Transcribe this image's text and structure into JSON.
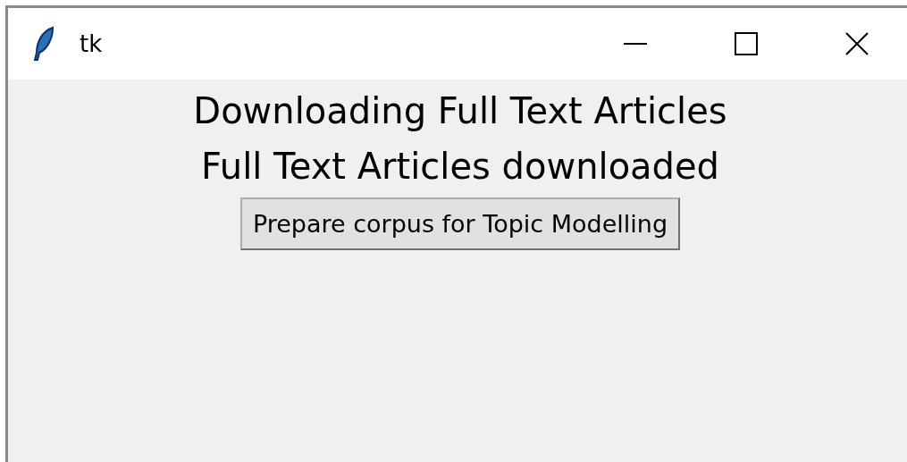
{
  "window": {
    "title": "tk"
  },
  "labels": [
    "Downloading Full Text Articles",
    "Full Text Articles downloaded"
  ],
  "button": "Prepare corpus for Topic Modelling"
}
